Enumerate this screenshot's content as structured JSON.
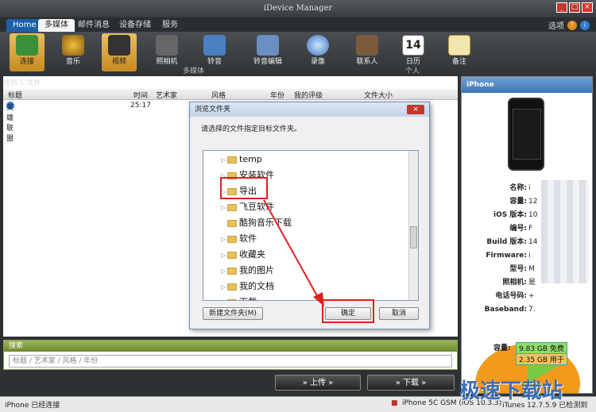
{
  "app": {
    "title": "iDevice Manager"
  },
  "window": {
    "min": "_",
    "max": "□",
    "close": "×"
  },
  "tabs": [
    {
      "label": "Home"
    },
    {
      "label": "多媒体"
    },
    {
      "label": "邮件消息"
    },
    {
      "label": "设备存储"
    },
    {
      "label": "服务"
    }
  ],
  "topright": {
    "options_label": "选项",
    "help_icon": "?",
    "info_icon": "i"
  },
  "toolbar": {
    "buttons": [
      {
        "label": "连接"
      },
      {
        "label": "音乐"
      },
      {
        "label": "视频"
      },
      {
        "label": "照相机"
      },
      {
        "label": "铃音"
      },
      {
        "label": "铃音编辑"
      },
      {
        "label": "录像"
      },
      {
        "label": "联系人"
      },
      {
        "label": "日历",
        "number": "14"
      },
      {
        "label": "备注"
      }
    ],
    "group_multimedia": "多媒体",
    "group_personal": "个人"
  },
  "list": {
    "found": "找到 1 文件",
    "columns": [
      "标题",
      "时间",
      "艺术家",
      "风格",
      "年份",
      "我的评级",
      "文件大小"
    ],
    "rows": [
      {
        "title": "英雄联盟",
        "time": "25:17"
      }
    ]
  },
  "dialog": {
    "title": "浏览文件夹",
    "close": "×",
    "message": "请选择的文件指定目标文件夹。",
    "folders": [
      "temp",
      "安装软件",
      "导出",
      "飞豆软件",
      "酷狗音乐下载",
      "软件",
      "收藏夹",
      "我的图片",
      "我的文档",
      "下载"
    ],
    "new_folder": "新建文件夹(M)",
    "ok": "确定",
    "cancel": "取消"
  },
  "search": {
    "header": "搜索",
    "placeholder": "标题 / 艺术家 / 风格 / 年份"
  },
  "buttons": {
    "upload": "» 上传 »",
    "download": "» 下载 »"
  },
  "status": {
    "connected": "iPhone 已经连接",
    "device": "iPhone 5C GSM (iOS 10.3.3)",
    "itunes": "iTunes 12.7.5.9 已检测到"
  },
  "device": {
    "header": "iPhone",
    "info": [
      {
        "k": "名称:",
        "v": "i"
      },
      {
        "k": "容量:",
        "v": "12"
      },
      {
        "k": "iOS 版本:",
        "v": "10"
      },
      {
        "k": "编号:",
        "v": "F"
      },
      {
        "k": "Build 版本:",
        "v": "14"
      },
      {
        "k": "Firmware:",
        "v": "i"
      },
      {
        "k": "型号:",
        "v": "M"
      },
      {
        "k": "照相机:",
        "v": "是"
      },
      {
        "k": "电话号码:",
        "v": "+"
      },
      {
        "k": "Baseband:",
        "v": "7."
      }
    ],
    "capacity_label": "容量:",
    "free": "9.83 GB 免费",
    "used": "2.35 GB 用于"
  },
  "watermark": "极速下载站",
  "colors": {
    "accent": "#1e5fa8",
    "highlight": "#e02020",
    "orange": "#f39a1c",
    "green": "#7ac943"
  }
}
